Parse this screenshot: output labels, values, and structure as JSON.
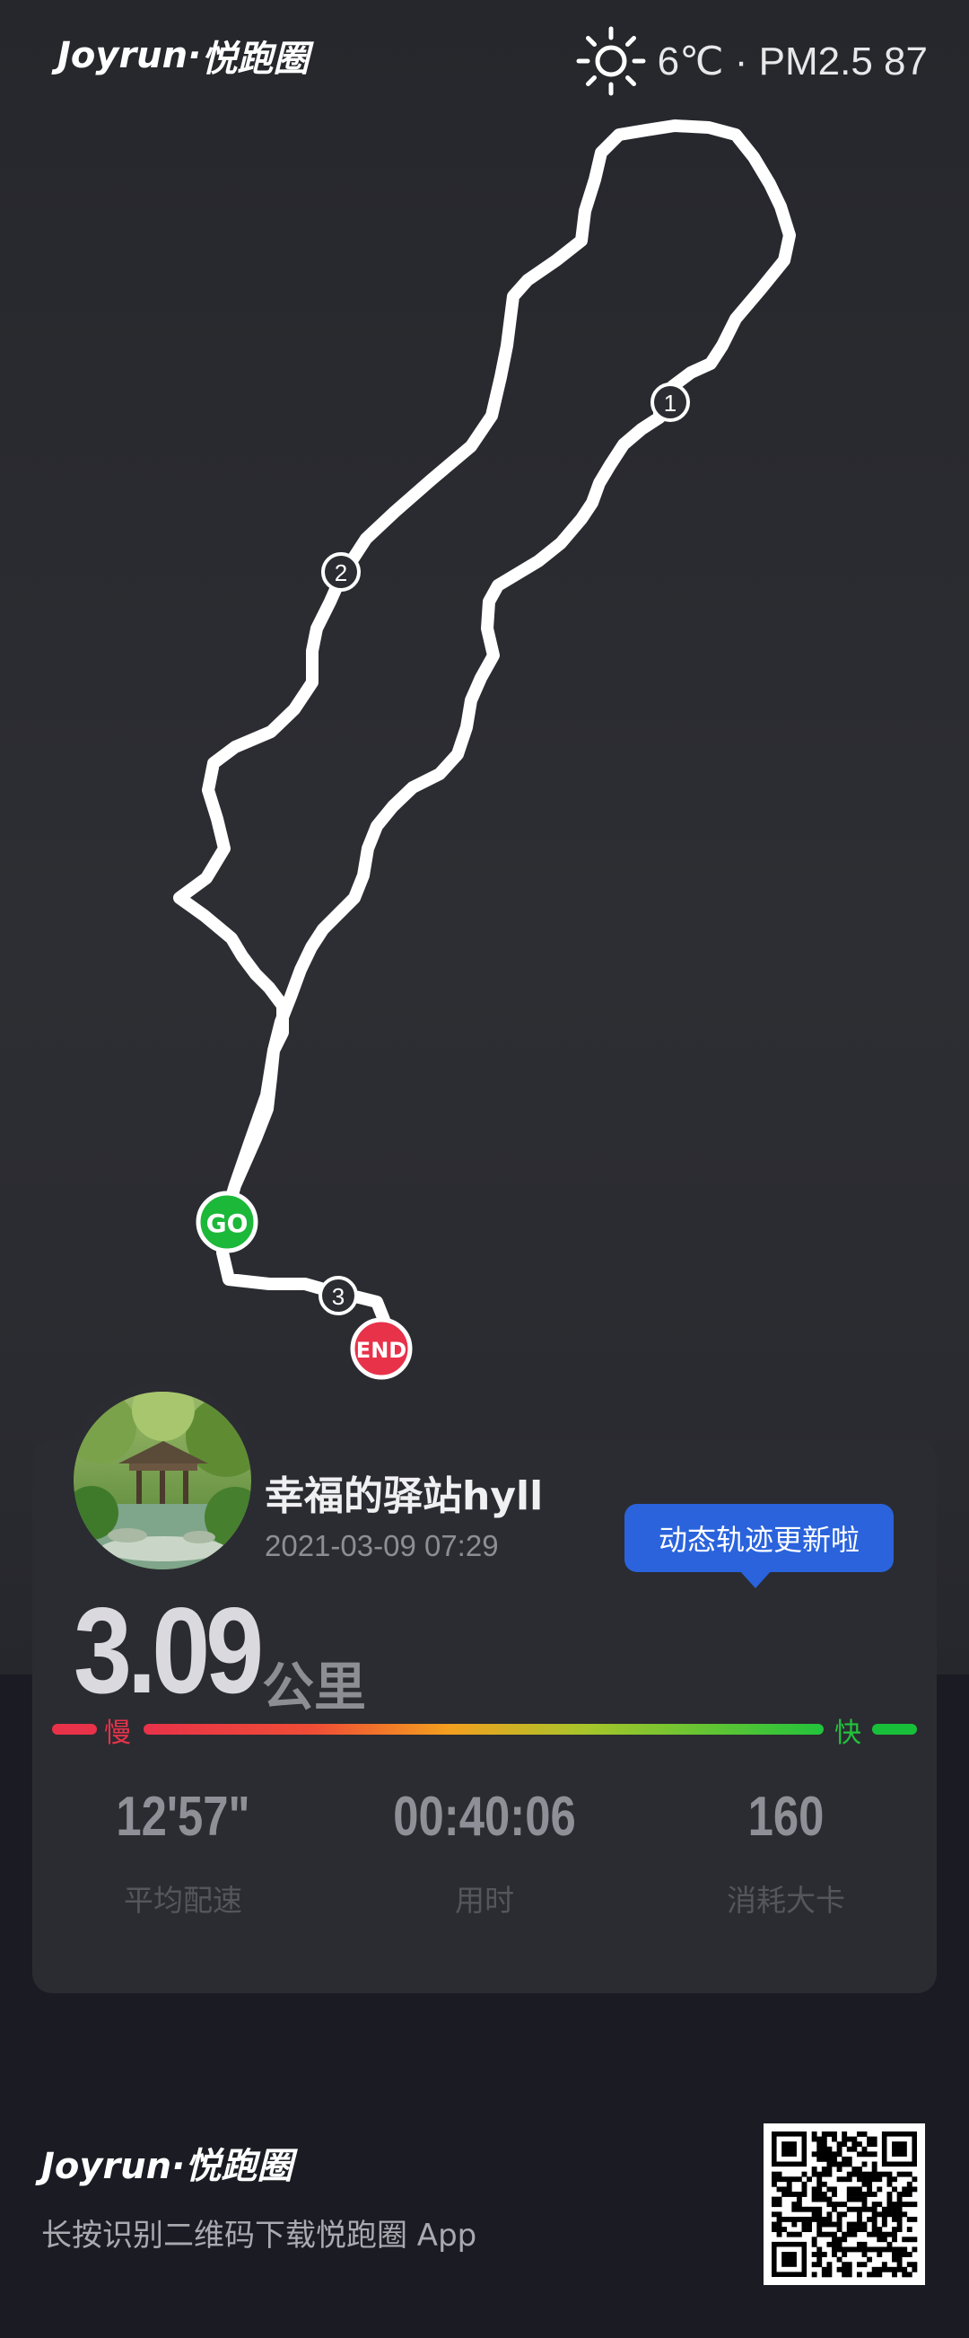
{
  "header": {
    "brand_latin": "Joyrun",
    "brand_cn": "悦跑圈",
    "weather_icon": "sun-icon",
    "weather_text": "6℃ · PM2.5 87"
  },
  "map": {
    "start_marker": "GO",
    "end_marker": "END",
    "km_markers": [
      "1",
      "2",
      "3"
    ],
    "route_color": "#ffffff",
    "start_color": "#1cb83a",
    "end_color": "#e8324a"
  },
  "activity": {
    "username": "幸福的驿站hyll",
    "datetime": "2021-03-09 07:29",
    "update_tip": "动态轨迹更新啦",
    "distance": "3.09",
    "distance_unit": "公里",
    "slow_label": "慢",
    "fast_label": "快",
    "stats": [
      {
        "value": "12'57\"",
        "label": "平均配速"
      },
      {
        "value": "00:40:06",
        "label": "用时"
      },
      {
        "value": "160",
        "label": "消耗大卡"
      }
    ]
  },
  "footer": {
    "brand_latin": "Joyrun",
    "brand_cn": "悦跑圈",
    "tip": "长按识别二维码下载悦跑圈 App"
  },
  "colors": {
    "accent_blue": "#2a63dc",
    "slow_red": "#e8324a",
    "fast_green": "#22c33c"
  }
}
